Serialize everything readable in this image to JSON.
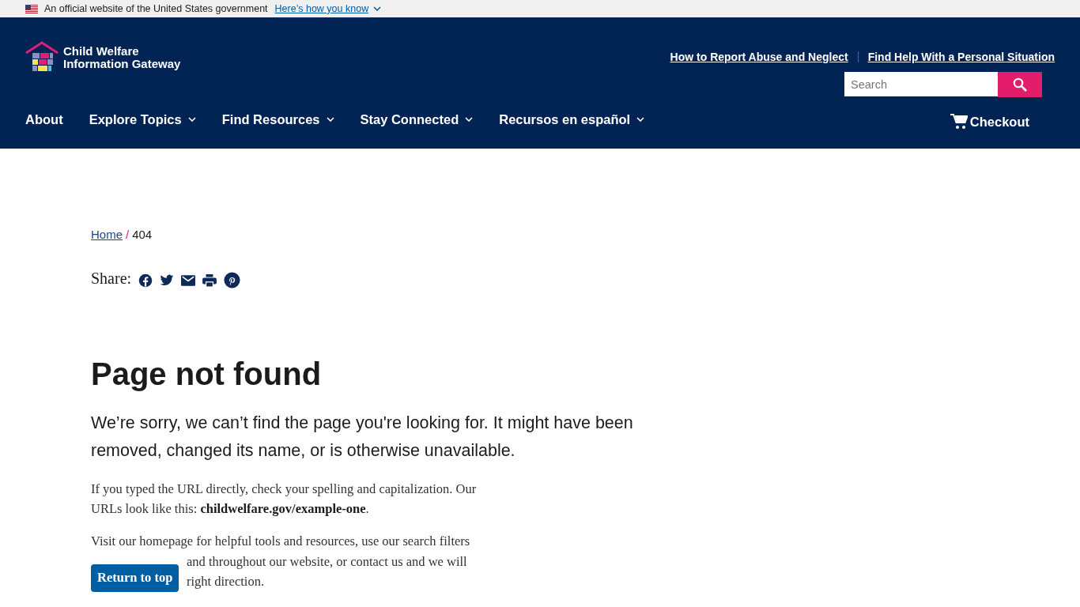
{
  "gov_banner": {
    "text": "An official website of the United States government",
    "link": "Here’s how you know"
  },
  "header": {
    "logo": {
      "line1": "Child Welfare",
      "line2": "Information Gateway"
    },
    "utility_links": [
      "How to Report Abuse and Neglect",
      "Find Help With a Personal Situation"
    ],
    "search": {
      "placeholder": "Search"
    },
    "nav": [
      {
        "label": "About",
        "dropdown": false
      },
      {
        "label": "Explore Topics",
        "dropdown": true
      },
      {
        "label": "Find Resources",
        "dropdown": true
      },
      {
        "label": "Stay Connected",
        "dropdown": true
      },
      {
        "label": "Recursos en español",
        "dropdown": true
      }
    ],
    "checkout": "Checkout"
  },
  "breadcrumb_separator": "/",
  "breadcrumb": [
    {
      "label": "Home",
      "link": true
    },
    {
      "label": "404",
      "link": false
    }
  ],
  "share": {
    "label": "Share:",
    "icons": [
      {
        "kind": "facebook"
      },
      {
        "kind": "twitter"
      },
      {
        "kind": "email"
      },
      {
        "kind": "print"
      },
      {
        "kind": "pinterest"
      }
    ]
  },
  "heading": "Page not found",
  "lead": "We’re sorry, we can’t find the page you're looking for. It might have been removed, changed its name, or is otherwise unavailable.",
  "paragraph_1": "If you typed the URL directly, check your spelling and capitalization. Our URLs look like this: **childwelfare.gov/example-one**.",
  "paragraph_2_lines": [
    "Visit our homepage for helpful tools and resources, use our search filters",
    "and throughout our website, or contact us and we will",
    "right direction."
  ],
  "return_to_top": "Return to top"
}
